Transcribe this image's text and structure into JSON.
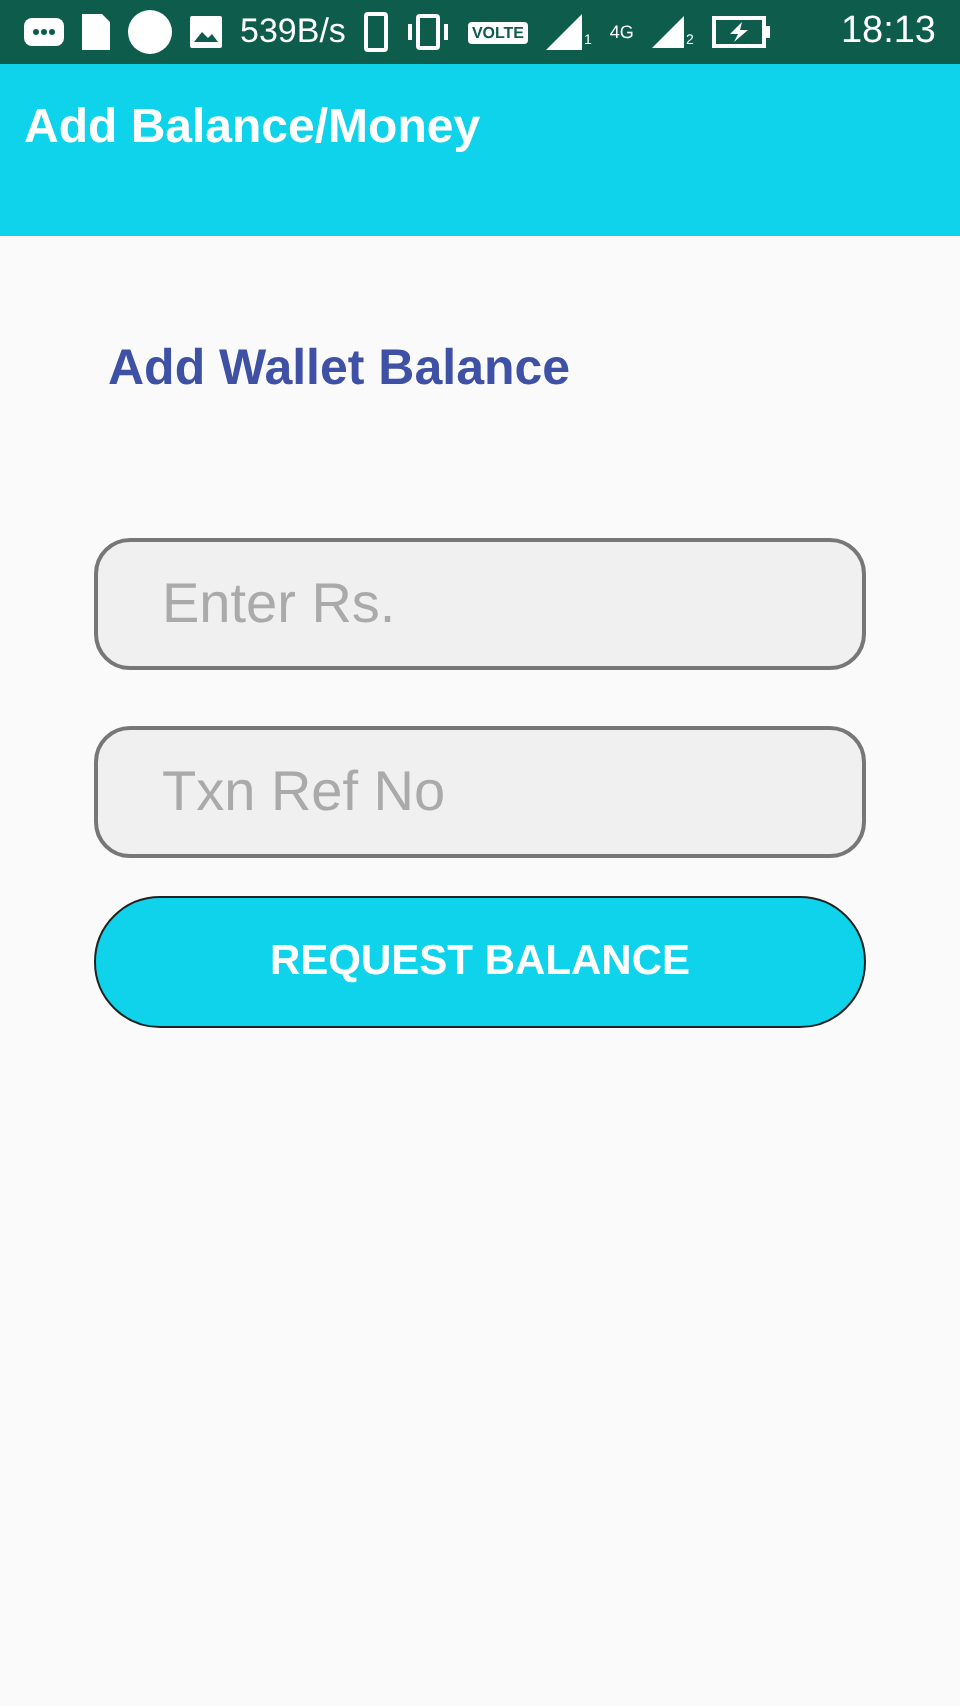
{
  "status_bar": {
    "speed": "539B/s",
    "volte": "VOLTE",
    "network": "4G",
    "sim_1": "1",
    "sim_2": "2",
    "time": "18:13"
  },
  "app_bar": {
    "title": "Add Balance/Money"
  },
  "form": {
    "heading": "Add Wallet Balance",
    "fields": [
      {
        "placeholder": "Enter Rs."
      },
      {
        "placeholder": "Txn Ref No"
      }
    ],
    "button": "REQUEST BALANCE"
  }
}
